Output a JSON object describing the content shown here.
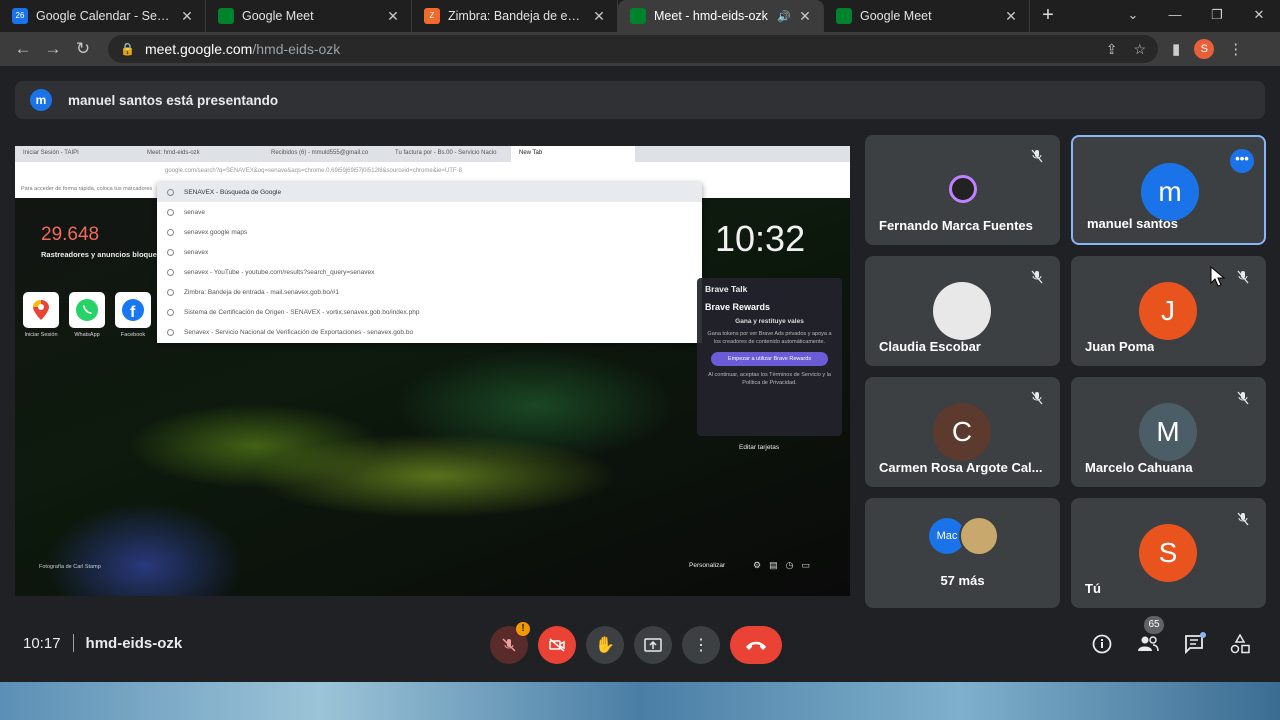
{
  "browser": {
    "tabs": [
      {
        "title": "Google Calendar - Semana d",
        "favicon_color": "#1a73e8",
        "favicon_text": "26",
        "active": false
      },
      {
        "title": "Google Meet",
        "favicon_color": "#00832d",
        "favicon_text": "",
        "active": false
      },
      {
        "title": "Zimbra: Bandeja de entrada |",
        "favicon_color": "#f06b2b",
        "favicon_text": "Z",
        "active": false
      },
      {
        "title": "Meet - hmd-eids-ozk",
        "favicon_color": "#00832d",
        "favicon_text": "",
        "active": true
      },
      {
        "title": "Google Meet",
        "favicon_color": "#00832d",
        "favicon_text": "",
        "active": false
      }
    ],
    "address": {
      "domain": "meet.google.com",
      "path": "/hmd-eids-ozk"
    },
    "profile_initial": "S"
  },
  "banner": {
    "avatar_initial": "m",
    "text": "manuel santos está presentando"
  },
  "presentation": {
    "tabs": [
      "Iniciar Sesión - TAIPI",
      "Meet: hmd-eids-ozk",
      "Recibidos (6) - mmuld555@gmail.co",
      "Tu factura por - Bs.00 - Servicio Nacio",
      "New Tab"
    ],
    "address": "google.com/search?q=SENAVEX&oq=senave&aqs=chrome.0.69i59j69i57j0i512l8&sourceid=chrome&ie=UTF-8",
    "bookmarks_hint": "Para acceder de forma rápida, coloca tus marcadores",
    "suggestions": [
      "SENAVEX - Búsqueda de Google",
      "senave",
      "senavex google maps",
      "senavex",
      "senavex - YouTube - youtube.com/results?search_query=senavex",
      "Zimbra: Bandeja de entrada - mail.senavex.gob.bo/#1",
      "Sistema de Certificación de Origen - SENAVEX - vortix.senavex.gob.bo/index.php",
      "Senavex - Servicio Nacional de Verificación de Exportaciones - senavex.gob.bo"
    ],
    "tracker_count": "29.648",
    "tracker_label": "Rastreadores y anuncios bloqueados",
    "shortcuts": [
      "Iniciar Sesión",
      "WhatsApp",
      "Facebook"
    ],
    "clock": "10:32",
    "brave_talk": "Brave Talk",
    "brave_rewards": "Brave Rewards",
    "rewards_sub": "Gana y restituye vales",
    "rewards_desc": "Gana tokens por ver Brave Ads privados y apoya a los creadores de contenido automáticamente.",
    "rewards_button": "Empezar a utilizar Brave Rewards",
    "rewards_terms": "Al continuar, aceptas los Términos de Servicio y la Política de Privacidad.",
    "edit_cards": "Editar tarjetas",
    "photo_credit": "Fotografía de Carl Stamp",
    "customize": "Personalizar"
  },
  "participants": [
    {
      "name": "Fernando Marca Fuentes",
      "initial": "",
      "color": "#202124",
      "muted": true,
      "speaker": false
    },
    {
      "name": "manuel santos",
      "initial": "m",
      "color": "#1a73e8",
      "muted": false,
      "speaker": true
    },
    {
      "name": "Claudia Escobar",
      "initial": "",
      "color": "#e8e8e8",
      "muted": true,
      "speaker": false
    },
    {
      "name": "Juan Poma",
      "initial": "J",
      "color": "#e8531e",
      "muted": true,
      "speaker": false
    },
    {
      "name": "Carmen Rosa Argote Cal...",
      "initial": "C",
      "color": "#5c3a2e",
      "muted": true,
      "speaker": false
    },
    {
      "name": "Marcelo Cahuana",
      "initial": "M",
      "color": "#4b5d67",
      "muted": true,
      "speaker": false
    },
    {
      "name": "57 más",
      "stack_label": "Mac",
      "muted": false,
      "speaker": false
    },
    {
      "name": "Tú",
      "initial": "S",
      "color": "#e8531e",
      "muted": true,
      "speaker": false
    }
  ],
  "meeting": {
    "time": "10:17",
    "code": "hmd-eids-ozk",
    "people_count": "65"
  },
  "colors": {
    "accent": "#8ab4f8",
    "danger": "#ea4335",
    "tile": "#3c4043",
    "background": "#202124"
  }
}
